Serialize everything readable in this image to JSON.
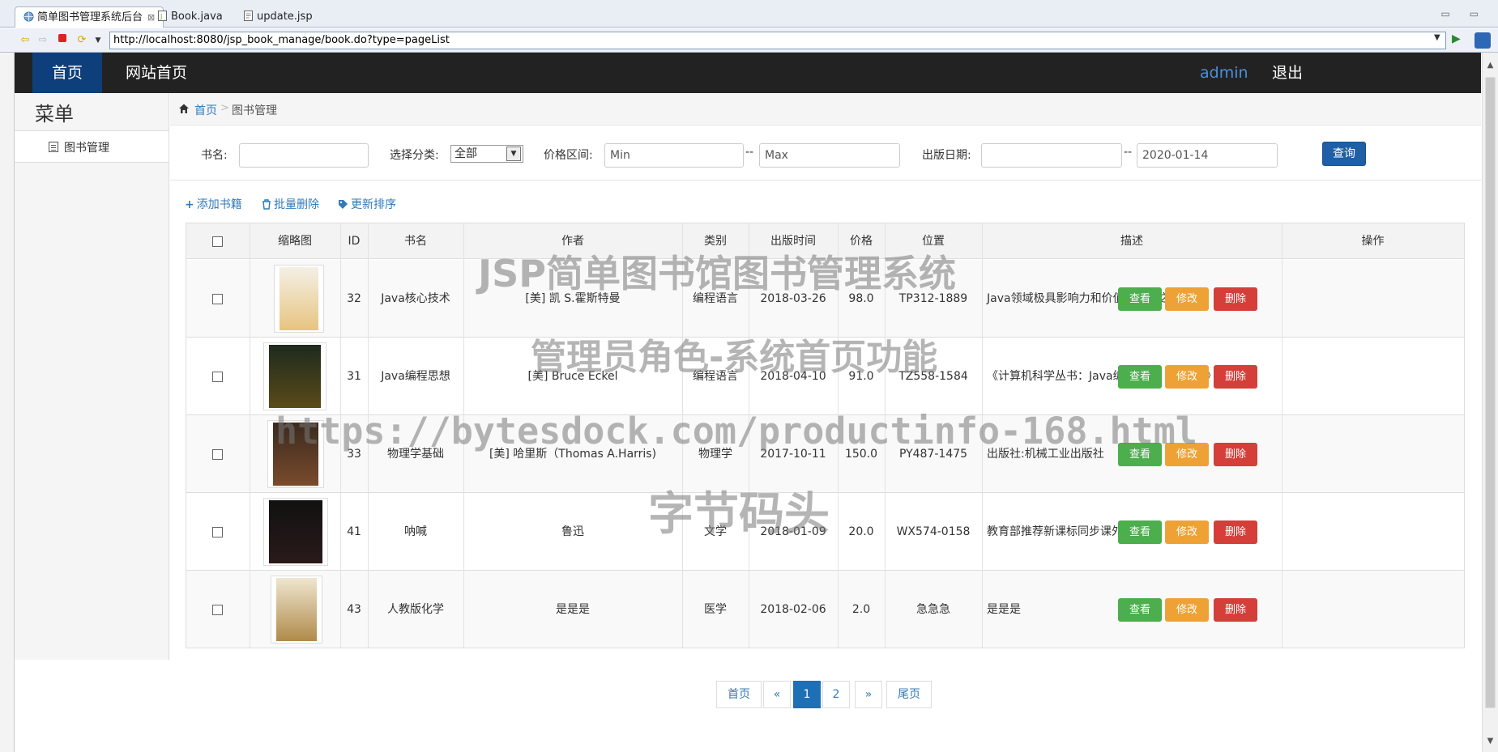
{
  "ide": {
    "tabs": [
      {
        "label": "简单图书管理系统后台",
        "close": "⊠"
      },
      {
        "label": "Book.java"
      },
      {
        "label": "update.jsp"
      }
    ],
    "url": "http://localhost:8080/jsp_book_manage/book.do?type=pageList"
  },
  "topnav": {
    "home": "首页",
    "site_home": "网站首页",
    "user": "admin",
    "logout": "退出"
  },
  "sidebar": {
    "title": "菜单",
    "items": [
      {
        "label": "图书管理"
      }
    ]
  },
  "breadcrumb": {
    "home": "首页",
    "separator": ">",
    "current": "图书管理"
  },
  "search": {
    "name_label": "书名:",
    "name_value": "",
    "category_label": "选择分类:",
    "category_selected": "全部",
    "price_label": "价格区间:",
    "price_min_placeholder": "Min",
    "price_max_placeholder": "Max",
    "date_label": "出版日期:",
    "date_from": "",
    "date_to": "2020-01-14",
    "range_sep": "--",
    "query_button": "查询"
  },
  "actions": {
    "add": "添加书籍",
    "batch_delete": "批量删除",
    "update_sort": "更新排序"
  },
  "table": {
    "columns": [
      "缩略图",
      "ID",
      "书名",
      "作者",
      "类别",
      "出版时间",
      "价格",
      "位置",
      "描述",
      "操作"
    ],
    "rows": [
      {
        "id": "32",
        "name": "Java核心技术",
        "author": "[美] 凯 S.霍斯特曼",
        "category": "编程语言",
        "date": "2018-03-26",
        "price": "98.0",
        "location": "TP312-1889",
        "desc": "Java领域极具影响力和价值的著作之一"
      },
      {
        "id": "31",
        "name": "Java编程思想",
        "author": "[美] Bruce Eckel",
        "category": "编程语言",
        "date": "2018-04-10",
        "price": "91.0",
        "location": "TZ558-1584",
        "desc": "《计算机科学丛书：Java编程思想（第4版）》"
      },
      {
        "id": "33",
        "name": "物理学基础",
        "author": "[美] 哈里斯（Thomas A.Harris)",
        "category": "物理学",
        "date": "2017-10-11",
        "price": "150.0",
        "location": "PY487-1475",
        "desc": "出版社:机械工业出版社"
      },
      {
        "id": "41",
        "name": "呐喊",
        "author": "鲁迅",
        "category": "文学",
        "date": "2018-01-09",
        "price": "20.0",
        "location": "WX574-0158",
        "desc": "教育部推荐新课标同步课外阅读"
      },
      {
        "id": "43",
        "name": "人教版化学",
        "author": "是是是",
        "category": "医学",
        "date": "2018-02-06",
        "price": "2.0",
        "location": "急急急",
        "desc": "是是是"
      }
    ],
    "ops": {
      "view": "查看",
      "edit": "修改",
      "delete": "删除"
    }
  },
  "pagination": {
    "first": "首页",
    "prev": "«",
    "pages": [
      "1",
      "2"
    ],
    "current": "1",
    "next": "»",
    "last": "尾页"
  },
  "watermark": {
    "line1": "JSP简单图书馆图书管理系统",
    "line2": "管理员角色-系统首页功能",
    "line3": "https://bytesdock.com/productinfo-168.html",
    "line4": "字节码头"
  },
  "colors": {
    "nav_bg": "#222222",
    "nav_active": "#0e3f7a",
    "link": "#337ab7",
    "primary": "#1f5fa7",
    "success": "#4cae4c",
    "warning": "#eea236",
    "danger": "#d43f3a"
  }
}
